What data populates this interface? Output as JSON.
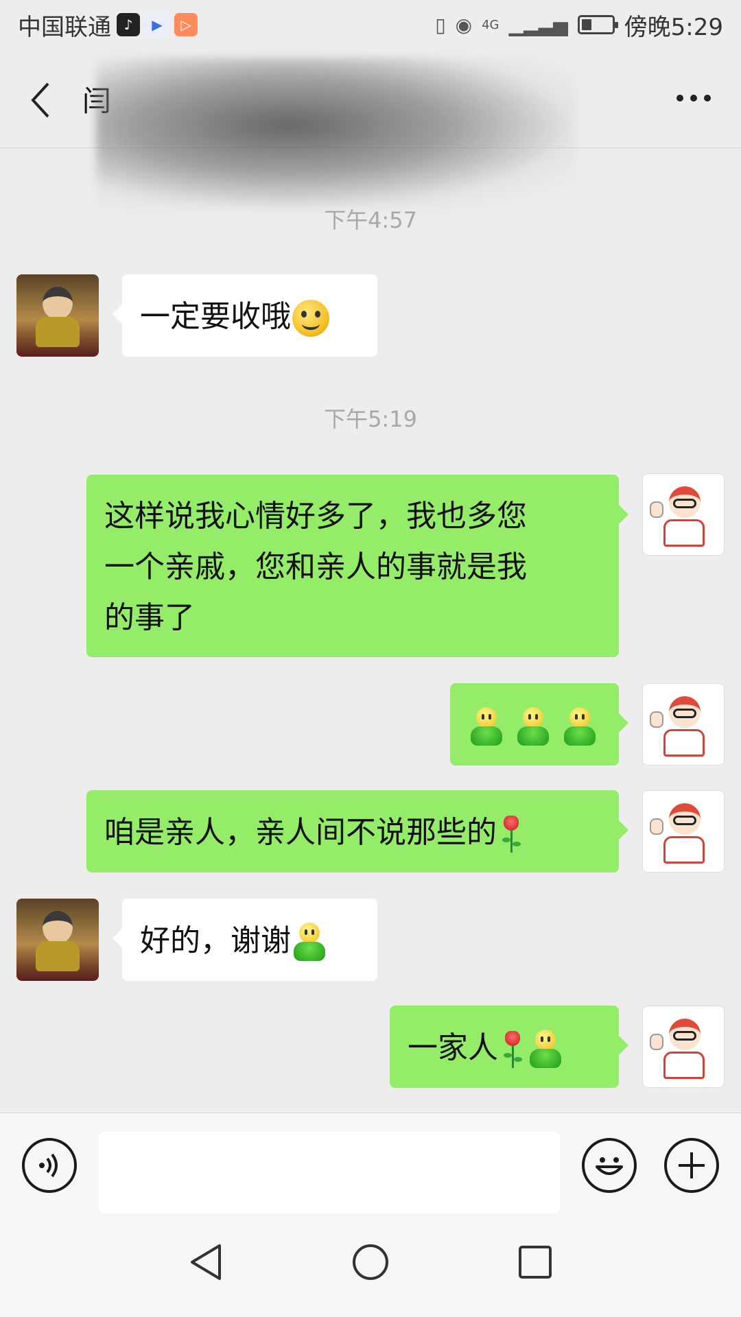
{
  "status_bar": {
    "carrier": "中国联通",
    "network": "4G",
    "time": "傍晚5:29",
    "battery_level": 0.25
  },
  "header": {
    "title": "闫"
  },
  "messages": [
    {
      "type": "time",
      "text": "下午4:57"
    },
    {
      "type": "text",
      "side": "left",
      "text": "一定要收哦",
      "emoji": "smile-icon"
    },
    {
      "type": "time",
      "text": "下午5:19"
    },
    {
      "type": "text",
      "side": "right",
      "lines": [
        "这样说我心情好多了，我也多您",
        "一个亲戚，您和亲人的事就是我",
        "的事了"
      ]
    },
    {
      "type": "emoji",
      "side": "right",
      "emoji": [
        "guy-icon",
        "guy-icon",
        "guy-icon"
      ]
    },
    {
      "type": "text",
      "side": "right",
      "text": "咱是亲人，亲人间不说那些的",
      "emoji": "rose-icon"
    },
    {
      "type": "text",
      "side": "left",
      "text": "好的，谢谢",
      "emoji": "guy-icon"
    },
    {
      "type": "text",
      "side": "right",
      "text": "一家人",
      "emoji": [
        "rose-icon",
        "guy-icon"
      ]
    }
  ],
  "input": {
    "value": "",
    "placeholder": ""
  },
  "colors": {
    "background": "#ededed",
    "bubble_right": "#95ec69",
    "bubble_left": "#ffffff"
  }
}
